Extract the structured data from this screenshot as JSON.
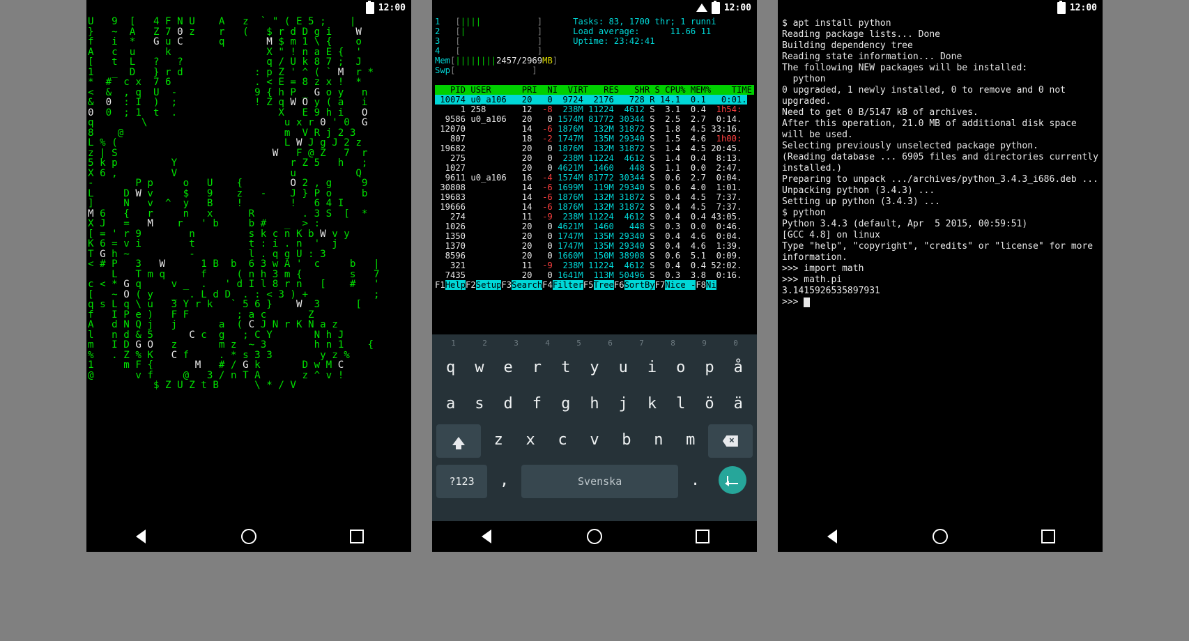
{
  "status": {
    "time": "12:00"
  },
  "screen1": {
    "matrix_lines": [
      "U   9  [   4 F N U    A   z  ` \" ( E 5 ;    |",
      "}   ~  A   Z 7 0 z    r   (   $ r d D g i    W",
      "f   i  *   G u C      q       M $ m 1 \\ {    o",
      "A   c  u     k                X \" ! n a E {  ' ",
      "[   t  L   ?   ?              q / U k 8 7 ;  J ",
      "1   _  D   } r d            : p Z ' ^ ( ` M  r *",
      "*  #  c x  7 6              . < E = 8 z x !  *  ",
      "<  &  , q  U  -             9 { h P _ G o y   n ",
      "&  0  : I  )  ;             ! Z q W O y ( a   i ",
      "0  0  ; 1  t  .                 X   E 9 h i   O ",
      "q        \\                       u x r 0 ' 0  G ",
      "8    @                           m  V R j 2 3   ",
      "L % (                            L W J g J 2 z  ",
      "z | S                          W   F @ Z   7  r ",
      "5 k p         Y                   r Z 5   h   ; ",
      "X 6 ,         V                   u          Q  ",
      "-       P p     o   U    {        O 2 , g     9 ",
      "L     D W v     $   9    z   -    J } P o     b ",
      "]     N   v  ^  y   B    !        !   6 4 I     ",
      "M 6   {   r     n   x      R        . 3 S  [  * ",
      "X J   =   M    r   ' b     b #   _  > :         ",
      "[ = ' r 9        n         s k c n K b W v y    ",
      "K 6 = v i        t         t : i . n  '  j      ",
      "T G h ~          -         l . q g U : 3        ",
      "< # P   3   W      1 B  b  6 3 w A '  c     b   |",
      "    L   T m q      f     ( n h 3 m {        s   7",
      "c < * G q     v _  .   ' d I l 8 r n   [    #   '",
      "[   ~ O ( y   _  . L d D  . : < 3 ) +           ;",
      "q s L q \\ u   3 Y r k   ` 5 6 }    W  3      [   ",
      "f   I P e )   F F        ; a c       Z          ",
      "A   d N Q j   j       a  ( C J N r K N a z      ",
      "l   n d & 5      C c  g   ; C Y       N h J     ",
      "m   I D G O   z       m z  ~ 3        h n 1    {",
      "%   . Z % K   C f     . * s 3 3        y z %    ",
      "1     m F {       M   # / G k       D w M C     ",
      "@       v f     @   3 / n T A       z ^ v !     ",
      "           $ Z U Z t B      \\ * / V             "
    ],
    "white_chars": [
      "G",
      "C",
      "W",
      "M",
      "W",
      "O",
      "W 3",
      "0"
    ]
  },
  "screen2": {
    "htop": {
      "cpu_bars": [
        "1  [||||           ]",
        "2  [|              ]",
        "3  [               ]",
        "4  [               ]"
      ],
      "mem": "Mem[||||||||2457/2969MB]",
      "swp": "Swp[               ]",
      "tasks": "Tasks: 83, 1700 thr; 1 runni",
      "load": "Load average:      11.66 11",
      "uptime": "Uptime: 23:42:41",
      "header": "   PID USER      PRI  NI  VIRT   RES   SHR S CPU% MEM%    TIME",
      "rows": [
        {
          "sel": true,
          "txt": " 10074 u0_a106   20   0  9724  2176   728 R 14.1  0.1   0:01."
        },
        {
          "pid": "    1",
          "user": "258",
          "pri": "12",
          "ni": "-8",
          "virt": " 238M",
          "res": "11224",
          "shr": " 4612",
          "s": "S",
          "cpu": " 3.1",
          "mem": " 0.4",
          "time": "1h54:"
        },
        {
          "pid": " 9586",
          "user": "u0_a106",
          "pri": "20",
          "ni": " 0",
          "virt": "1574M",
          "res": "81772",
          "shr": "30344",
          "s": "S",
          "cpu": " 2.5",
          "mem": " 2.7",
          "time": " 0:14."
        },
        {
          "pid": "12070",
          "user": "",
          "pri": "14",
          "ni": "-6",
          "virt": "1876M",
          "res": " 132M",
          "shr": "31872",
          "s": "S",
          "cpu": " 1.8",
          "mem": " 4.5",
          "time": "33:16."
        },
        {
          "pid": "  807",
          "user": "",
          "pri": "18",
          "ni": "-2",
          "virt": "1747M",
          "res": " 135M",
          "shr": "29340",
          "s": "S",
          "cpu": " 1.5",
          "mem": " 4.6",
          "time": "1h00:"
        },
        {
          "pid": "19682",
          "user": "",
          "pri": "20",
          "ni": " 0",
          "virt": "1876M",
          "res": " 132M",
          "shr": "31872",
          "s": "S",
          "cpu": " 1.4",
          "mem": " 4.5",
          "time": "20:45."
        },
        {
          "pid": "  275",
          "user": "",
          "pri": "20",
          "ni": " 0",
          "virt": " 238M",
          "res": "11224",
          "shr": " 4612",
          "s": "S",
          "cpu": " 1.4",
          "mem": " 0.4",
          "time": " 8:13."
        },
        {
          "pid": " 1027",
          "user": "",
          "pri": "20",
          "ni": " 0",
          "virt": "4621M",
          "res": " 1460",
          "shr": "  448",
          "s": "S",
          "cpu": " 1.1",
          "mem": " 0.0",
          "time": " 2:47."
        },
        {
          "pid": " 9611",
          "user": "u0_a106",
          "pri": "16",
          "ni": "-4",
          "virt": "1574M",
          "res": "81772",
          "shr": "30344",
          "s": "S",
          "cpu": " 0.6",
          "mem": " 2.7",
          "time": " 0:04."
        },
        {
          "pid": "30808",
          "user": "",
          "pri": "14",
          "ni": "-6",
          "virt": "1699M",
          "res": " 119M",
          "shr": "29340",
          "s": "S",
          "cpu": " 0.6",
          "mem": " 4.0",
          "time": " 1:01."
        },
        {
          "pid": "19683",
          "user": "",
          "pri": "14",
          "ni": "-6",
          "virt": "1876M",
          "res": " 132M",
          "shr": "31872",
          "s": "S",
          "cpu": " 0.4",
          "mem": " 4.5",
          "time": " 7:37."
        },
        {
          "pid": "19666",
          "user": "",
          "pri": "14",
          "ni": "-6",
          "virt": "1876M",
          "res": " 132M",
          "shr": "31872",
          "s": "S",
          "cpu": " 0.4",
          "mem": " 4.5",
          "time": " 7:37."
        },
        {
          "pid": "  274",
          "user": "",
          "pri": "11",
          "ni": "-9",
          "virt": " 238M",
          "res": "11224",
          "shr": " 4612",
          "s": "S",
          "cpu": " 0.4",
          "mem": " 0.4",
          "time": "43:05."
        },
        {
          "pid": " 1026",
          "user": "",
          "pri": "20",
          "ni": " 0",
          "virt": "4621M",
          "res": " 1460",
          "shr": "  448",
          "s": "S",
          "cpu": " 0.3",
          "mem": " 0.0",
          "time": " 0:46."
        },
        {
          "pid": " 1350",
          "user": "",
          "pri": "20",
          "ni": " 0",
          "virt": "1747M",
          "res": " 135M",
          "shr": "29340",
          "s": "S",
          "cpu": " 0.4",
          "mem": " 4.6",
          "time": " 0:04."
        },
        {
          "pid": " 1370",
          "user": "",
          "pri": "20",
          "ni": " 0",
          "virt": "1747M",
          "res": " 135M",
          "shr": "29340",
          "s": "S",
          "cpu": " 0.4",
          "mem": " 4.6",
          "time": " 1:39."
        },
        {
          "pid": " 8596",
          "user": "",
          "pri": "20",
          "ni": " 0",
          "virt": "1660M",
          "res": " 150M",
          "shr": "38908",
          "s": "S",
          "cpu": " 0.6",
          "mem": " 5.1",
          "time": " 0:09."
        },
        {
          "pid": "  321",
          "user": "",
          "pri": "11",
          "ni": "-9",
          "virt": " 238M",
          "res": "11224",
          "shr": " 4612",
          "s": "S",
          "cpu": " 0.4",
          "mem": " 0.4",
          "time": "52:02."
        },
        {
          "pid": " 7435",
          "user": "",
          "pri": "20",
          "ni": " 0",
          "virt": "1641M",
          "res": " 113M",
          "shr": "50496",
          "s": "S",
          "cpu": " 0.3",
          "mem": " 3.8",
          "time": " 0:16."
        }
      ],
      "fkeys": [
        [
          "F1",
          "Help"
        ],
        [
          "F2",
          "Setup"
        ],
        [
          "F3",
          "Search"
        ],
        [
          "F4",
          "Filter"
        ],
        [
          "F5",
          "Tree"
        ],
        [
          "F6",
          "SortBy"
        ],
        [
          "F7",
          "Nice -"
        ],
        [
          "F8",
          "Ni"
        ]
      ]
    },
    "keyboard": {
      "digits": [
        "1",
        "2",
        "3",
        "4",
        "5",
        "6",
        "7",
        "8",
        "9",
        "0"
      ],
      "row1": [
        "q",
        "w",
        "e",
        "r",
        "t",
        "y",
        "u",
        "i",
        "o",
        "p",
        "å"
      ],
      "row2": [
        "a",
        "s",
        "d",
        "f",
        "g",
        "h",
        "j",
        "k",
        "l",
        "ö",
        "ä"
      ],
      "row3": [
        "⇧",
        "z",
        "x",
        "c",
        "v",
        "b",
        "n",
        "m",
        "⌫"
      ],
      "row4_sym": "?123",
      "row4_space": "Svenska",
      "row4_comma": ",",
      "row4_period": "."
    }
  },
  "screen3": {
    "lines": [
      "$ apt install python",
      "Reading package lists... Done",
      "Building dependency tree",
      "Reading state information... Done",
      "The following NEW packages will be installed:",
      "  python",
      "0 upgraded, 1 newly installed, 0 to remove and 0 not upgraded.",
      "Need to get 0 B/5147 kB of archives.",
      "After this operation, 21.0 MB of additional disk space will be used.",
      "Selecting previously unselected package python.",
      "(Reading database ... 6905 files and directories currently installed.)",
      "Preparing to unpack .../archives/python_3.4.3_i686.deb ...",
      "Unpacking python (3.4.3) ...",
      "Setting up python (3.4.3) ...",
      "$ python",
      "Python 3.4.3 (default, Apr  5 2015, 00:59:51)",
      "[GCC 4.8] on linux",
      "Type \"help\", \"copyright\", \"credits\" or \"license\" for more information.",
      ">>> import math",
      ">>> math.pi",
      "3.1415926535897931",
      ">>> "
    ]
  }
}
